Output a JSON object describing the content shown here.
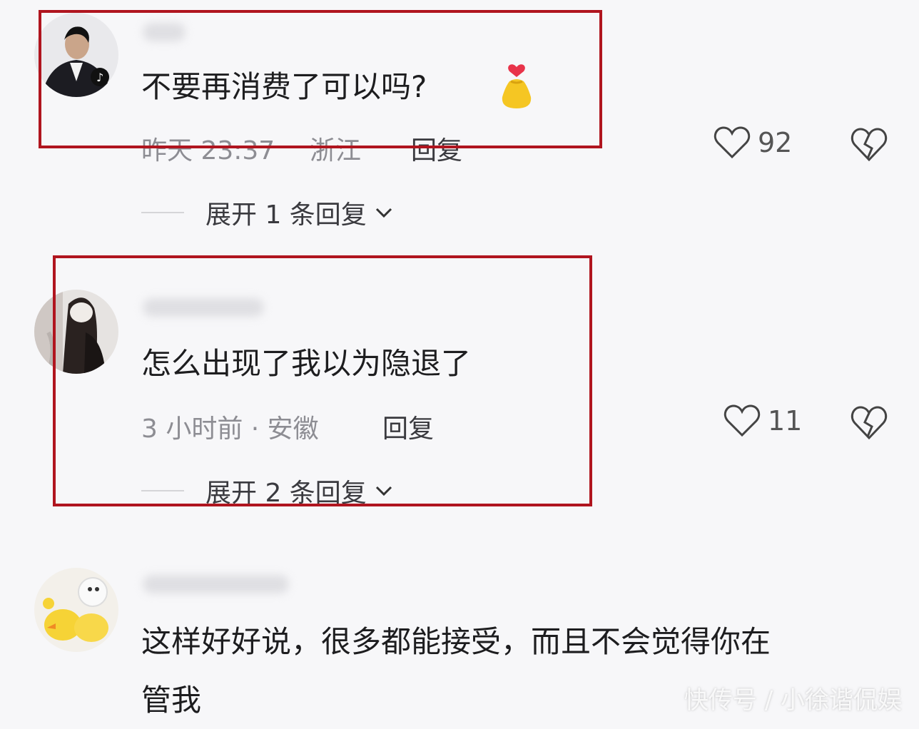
{
  "comments": [
    {
      "text": "不要再消费了可以吗?",
      "time": "昨天 23:37",
      "location": "浙江",
      "reply_label": "回复",
      "likes": "92",
      "expand_label": "展开 1 条回复"
    },
    {
      "text": "怎么出现了我以为隐退了",
      "meta": "3 小时前 · 安徽",
      "reply_label": "回复",
      "likes": "11",
      "expand_label": "展开 2 条回复"
    },
    {
      "text_line1": "这样好好说，很多都能接受，而且不会觉得你在",
      "text_line2": "管我"
    }
  ],
  "watermark": "快传号 / 小徐谐侃娱",
  "colors": {
    "highlight_box": "#b0151f",
    "background": "#f7f7f9"
  },
  "icons": [
    "tiktok-badge-icon",
    "heart-icon",
    "broken-heart-icon",
    "chevron-down-icon",
    "money-bag-emoji-icon"
  ]
}
